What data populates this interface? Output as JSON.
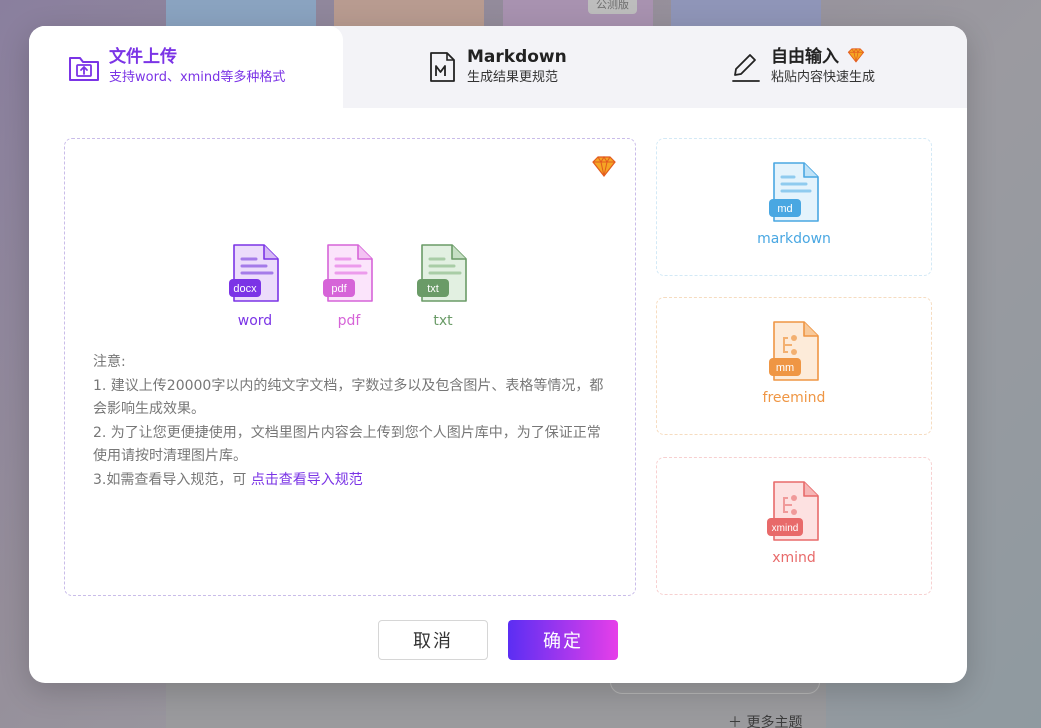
{
  "background": {
    "badge": "公测版",
    "more_topics": "更多主题"
  },
  "tabs": [
    {
      "title": "文件上传",
      "subtitle": "支持word、xmind等多种格式",
      "icon": "upload-folder-icon"
    },
    {
      "title": "Markdown",
      "subtitle": "生成结果更规范",
      "icon": "markdown-file-icon"
    },
    {
      "title": "自由输入",
      "subtitle": "粘贴内容快速生成",
      "icon": "pen-icon"
    }
  ],
  "upload": {
    "file_types": [
      {
        "label": "word",
        "badge": "docx",
        "color": "#7b34e6"
      },
      {
        "label": "pdf",
        "badge": "pdf",
        "color": "#d664d8"
      },
      {
        "label": "txt",
        "badge": "txt",
        "color": "#6a9b67"
      }
    ],
    "notes": {
      "heading": "注意:",
      "line1": "1. 建议上传20000字以内的纯文字文档，字数过多以及包含图片、表格等情况，都会影响生成效果。",
      "line2": "2. 为了让您更便捷使用，文档里图片内容会上传到您个人图片库中，为了保证正常使用请按时清理图片库。",
      "line3_prefix": "3.如需查看导入规范，可 ",
      "line3_link": "点击查看导入规范"
    }
  },
  "formats": [
    {
      "label": "markdown",
      "badge": "md",
      "color": "#49a7e2"
    },
    {
      "label": "freemind",
      "badge": "mm",
      "color": "#ef9644"
    },
    {
      "label": "xmind",
      "badge": "xmind",
      "color": "#e86a6a"
    }
  ],
  "buttons": {
    "cancel": "取消",
    "confirm": "确定"
  },
  "colors": {
    "accent": "#7b34e6",
    "confirm_gradient_start": "#5b2ef3",
    "confirm_gradient_end": "#e63fe9"
  }
}
